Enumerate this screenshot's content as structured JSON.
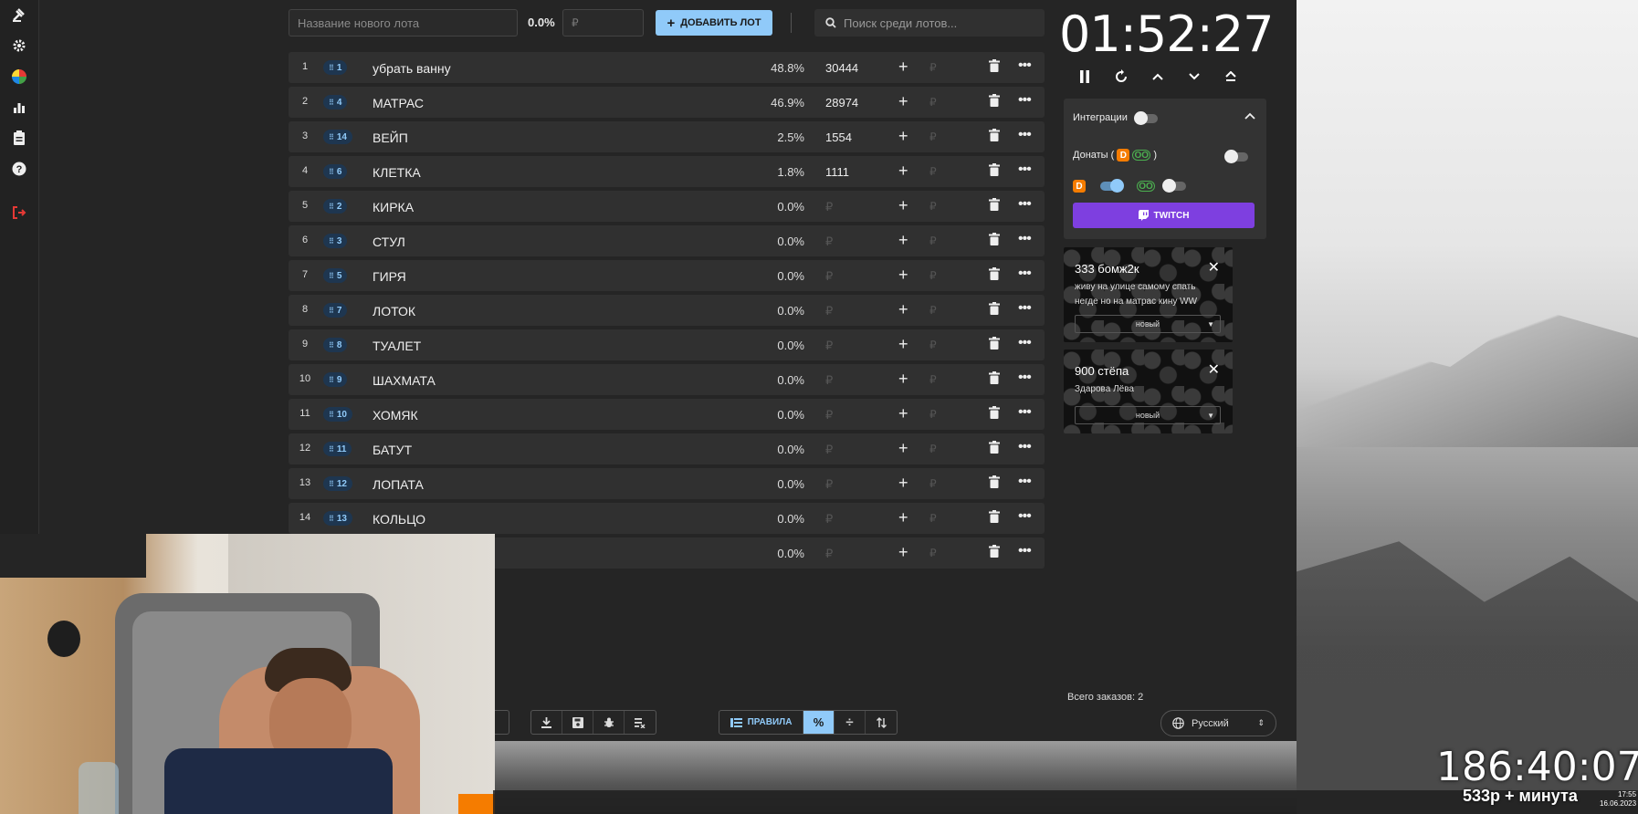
{
  "toolbar": {
    "lot_name_placeholder": "Название нового лота",
    "percent": "0.0%",
    "amount_placeholder": "₽",
    "add_lot_label": "ДОБАВИТЬ ЛОТ",
    "search_placeholder": "Поиск среди лотов..."
  },
  "lots": [
    {
      "index": "1",
      "id": "1",
      "name": "убрать ванну",
      "percent": "48.8%",
      "amount": "30444"
    },
    {
      "index": "2",
      "id": "4",
      "name": "МАТРАС",
      "percent": "46.9%",
      "amount": "28974"
    },
    {
      "index": "3",
      "id": "14",
      "name": "ВЕЙП",
      "percent": "2.5%",
      "amount": "1554"
    },
    {
      "index": "4",
      "id": "6",
      "name": "КЛЕТКА",
      "percent": "1.8%",
      "amount": "1111"
    },
    {
      "index": "5",
      "id": "2",
      "name": "КИРКА",
      "percent": "0.0%",
      "amount": "₽"
    },
    {
      "index": "6",
      "id": "3",
      "name": "СТУЛ",
      "percent": "0.0%",
      "amount": "₽"
    },
    {
      "index": "7",
      "id": "5",
      "name": "ГИРЯ",
      "percent": "0.0%",
      "amount": "₽"
    },
    {
      "index": "8",
      "id": "7",
      "name": "ЛОТОК",
      "percent": "0.0%",
      "amount": "₽"
    },
    {
      "index": "9",
      "id": "8",
      "name": "ТУАЛЕТ",
      "percent": "0.0%",
      "amount": "₽"
    },
    {
      "index": "10",
      "id": "9",
      "name": "ШАХМАТА",
      "percent": "0.0%",
      "amount": "₽"
    },
    {
      "index": "11",
      "id": "10",
      "name": "ХОМЯК",
      "percent": "0.0%",
      "amount": "₽"
    },
    {
      "index": "12",
      "id": "11",
      "name": "БАТУТ",
      "percent": "0.0%",
      "amount": "₽"
    },
    {
      "index": "13",
      "id": "12",
      "name": "ЛОПАТА",
      "percent": "0.0%",
      "amount": "₽"
    },
    {
      "index": "14",
      "id": "13",
      "name": "КОЛЬЦО",
      "percent": "0.0%",
      "amount": "₽"
    },
    {
      "index": "",
      "id": "",
      "name": "",
      "percent": "0.0%",
      "amount": "₽"
    }
  ],
  "lot_ruble_symbol": "₽",
  "timer": "01:52:27",
  "integrations": {
    "title": "Интеграции",
    "donations_label": "Донаты (",
    "donations_close": ")",
    "twitch_label": "TWITCH",
    "da_icon": "D",
    "dx_icon": "OO"
  },
  "donations": [
    {
      "amount": "333 бомж2к",
      "message": "живу на улице самому спать негде но на матрас кину WW",
      "status": "новый"
    },
    {
      "amount": "900 стёпа",
      "message": "Здарова Лёва",
      "status": "новый"
    }
  ],
  "bottom_toolbar": {
    "rules_label": "ПРАВИЛА"
  },
  "orders_total": "Всего заказов: 2",
  "language": "Русский",
  "overlay": {
    "stream_timer": "186:40:07",
    "rate": "533р + минута",
    "clock_time": "17:55",
    "clock_date": "16.06.2023"
  },
  "colors": {
    "accent": "#90caf9",
    "twitch": "#7e3fe0",
    "panel": "#303030"
  }
}
